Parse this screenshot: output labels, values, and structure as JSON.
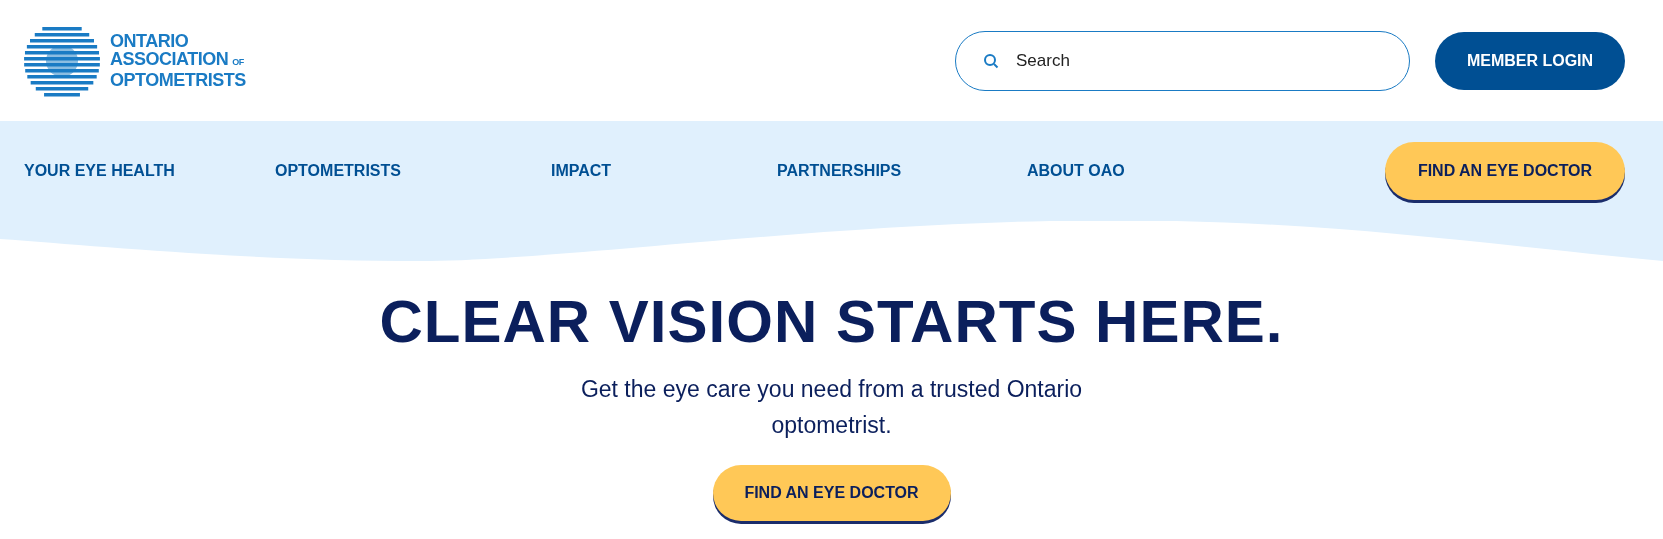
{
  "logo": {
    "line1": "ONTARIO",
    "line2": "ASSOCIATION",
    "small": "OF",
    "line3": "OPTOMETRISTS"
  },
  "search": {
    "placeholder": "Search"
  },
  "login_button": "MEMBER LOGIN",
  "nav": {
    "items": [
      "YOUR EYE HEALTH",
      "OPTOMETRISTS",
      "IMPACT",
      "PARTNERSHIPS",
      "ABOUT OAO"
    ],
    "cta": "FIND AN EYE DOCTOR"
  },
  "hero": {
    "title": "CLEAR VISION STARTS HERE.",
    "subtitle": "Get the eye care you need from a trusted Ontario optometrist.",
    "cta": "FIND AN EYE DOCTOR"
  }
}
